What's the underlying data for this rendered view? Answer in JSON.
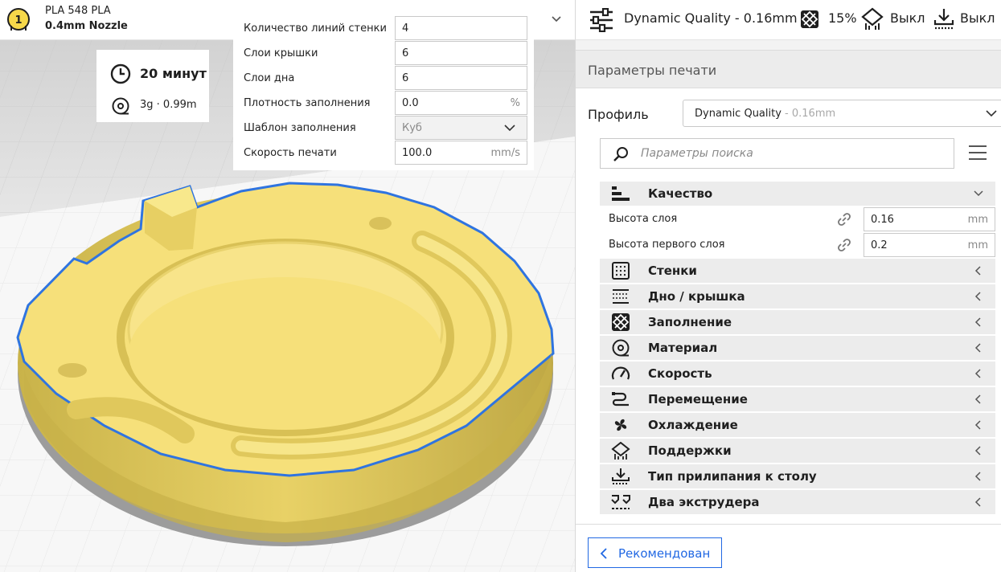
{
  "header": {
    "extruder_number": "1",
    "material": "PLA 548 PLA",
    "nozzle": "0.4mm Nozzle"
  },
  "estimate": {
    "time": "20 минут",
    "material_use": "3g · 0.99m"
  },
  "recommended_popup": {
    "rows": [
      {
        "label": "Количество линий стенки",
        "value": "4",
        "unit": ""
      },
      {
        "label": "Слои крышки",
        "value": "6",
        "unit": ""
      },
      {
        "label": "Слои дна",
        "value": "6",
        "unit": ""
      },
      {
        "label": "Плотность заполнения",
        "value": "0.0",
        "unit": "%"
      },
      {
        "label": "Шаблон заполнения",
        "value": "Куб",
        "unit": ""
      },
      {
        "label": "Скорость печати",
        "value": "100.0",
        "unit": "mm/s"
      }
    ]
  },
  "summary_bar": {
    "profile": "Dynamic Quality - 0.16mm",
    "infill": "15%",
    "support": "Выкл",
    "adhesion": "Выкл"
  },
  "panel": {
    "title": "Параметры печати",
    "profile_label": "Профиль",
    "profile_name": "Dynamic Quality",
    "profile_suffix": " - 0.16mm",
    "search_placeholder": "Параметры поиска",
    "categories": [
      {
        "label": "Качество",
        "icon": "quality-icon",
        "expanded": true
      },
      {
        "label": "Стенки",
        "icon": "walls-icon"
      },
      {
        "label": "Дно / крышка",
        "icon": "top-bottom-icon"
      },
      {
        "label": "Заполнение",
        "icon": "infill-icon"
      },
      {
        "label": "Материал",
        "icon": "material-icon"
      },
      {
        "label": "Скорость",
        "icon": "speed-icon"
      },
      {
        "label": "Перемещение",
        "icon": "travel-icon"
      },
      {
        "label": "Охлаждение",
        "icon": "cooling-icon"
      },
      {
        "label": "Поддержки",
        "icon": "support-icon"
      },
      {
        "label": "Тип прилипания к столу",
        "icon": "adhesion-icon"
      },
      {
        "label": "Два экструдера",
        "icon": "dual-extruder-icon"
      }
    ],
    "quality_settings": [
      {
        "label": "Высота слоя",
        "value": "0.16",
        "unit": "mm"
      },
      {
        "label": "Высота первого слоя",
        "value": "0.2",
        "unit": "mm"
      }
    ],
    "mode_button": "Рекомендован"
  },
  "colors": {
    "accent": "#2168e3",
    "model_yellow": "#f6e07a",
    "model_outline": "#2f74e0",
    "build_plate": "#d9d9d9"
  }
}
